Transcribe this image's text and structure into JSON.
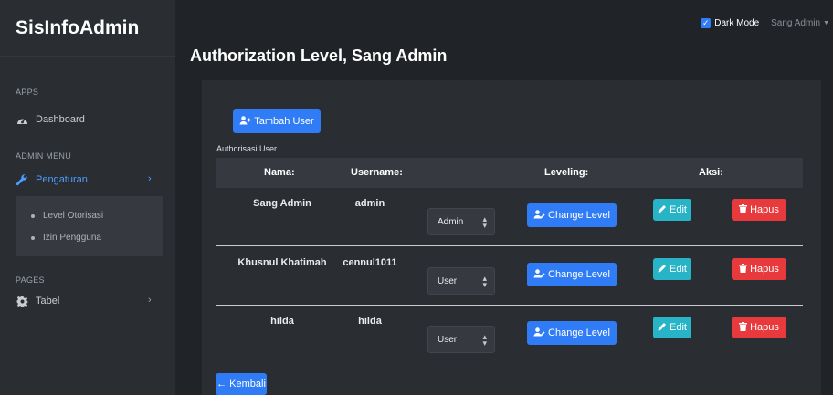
{
  "sidebar": {
    "brand": "SisInfoAdmin",
    "headings": {
      "apps": "APPS",
      "admin_menu": "ADMIN MENU",
      "pages": "PAGES"
    },
    "items": [
      {
        "label": "Dashboard",
        "icon": "tachometer-icon"
      },
      {
        "label": "Pengaturan",
        "icon": "wrench-icon",
        "active": true
      },
      {
        "label": "Tabel",
        "icon": "gear-icon"
      }
    ],
    "submenu": [
      {
        "label": "Level Otorisasi"
      },
      {
        "label": "Izin Pengguna"
      }
    ]
  },
  "topbar": {
    "dark_mode_label": "Dark Mode",
    "dark_mode_checked": true,
    "user_name": "Sang Admin"
  },
  "page": {
    "title": "Authorization Level, Sang Admin"
  },
  "card": {
    "add_button": "Tambah User",
    "label": "Authorisasi User",
    "columns": [
      "Nama:",
      "Username:",
      "Leveling:",
      "Aksi:"
    ],
    "rows": [
      {
        "nama": "Sang Admin",
        "username": "admin",
        "level": "Admin",
        "change_label": "Change Level",
        "edit_label": "Edit",
        "delete_label": "Hapus"
      },
      {
        "nama": "Khusnul Khatimah",
        "username": "cennul1011",
        "level": "User",
        "change_label": "Change Level",
        "edit_label": "Edit",
        "delete_label": "Hapus"
      },
      {
        "nama": "hilda",
        "username": "hilda",
        "level": "User",
        "change_label": "Change Level",
        "edit_label": "Edit",
        "delete_label": "Hapus"
      }
    ],
    "back_button": "← Kembali"
  },
  "colors": {
    "primary": "#2f7cf6",
    "info": "#27b4c7",
    "danger": "#e8393c",
    "background": "#202327",
    "sidebar": "#2a2e33"
  }
}
